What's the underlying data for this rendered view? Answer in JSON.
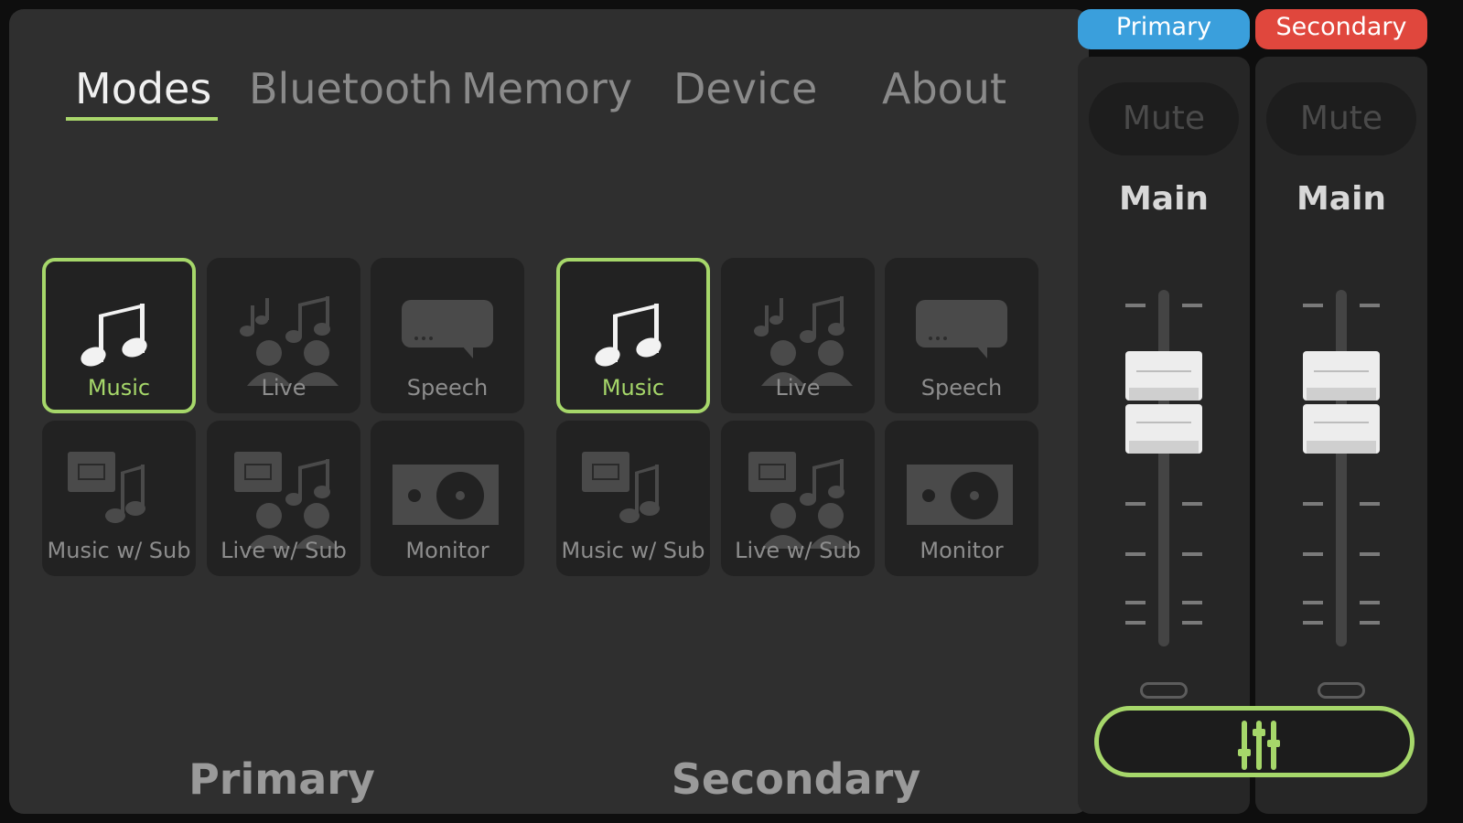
{
  "tabs": [
    {
      "label": "Modes",
      "active": true
    },
    {
      "label": "Bluetooth",
      "active": false
    },
    {
      "label": "Memory",
      "active": false
    },
    {
      "label": "Device",
      "active": false
    },
    {
      "label": "About",
      "active": false
    }
  ],
  "groups": [
    {
      "label": "Primary",
      "modes": [
        {
          "label": "Music",
          "icon": "music-note-icon",
          "selected": true
        },
        {
          "label": "Live",
          "icon": "live-audience-icon",
          "selected": false
        },
        {
          "label": "Speech",
          "icon": "speech-bubble-icon",
          "selected": false
        },
        {
          "label": "Music w/ Sub",
          "icon": "music-sub-icon",
          "selected": false
        },
        {
          "label": "Live w/ Sub",
          "icon": "live-sub-icon",
          "selected": false
        },
        {
          "label": "Monitor",
          "icon": "monitor-speaker-icon",
          "selected": false
        }
      ]
    },
    {
      "label": "Secondary",
      "modes": [
        {
          "label": "Music",
          "icon": "music-note-icon",
          "selected": true
        },
        {
          "label": "Live",
          "icon": "live-audience-icon",
          "selected": false
        },
        {
          "label": "Speech",
          "icon": "speech-bubble-icon",
          "selected": false
        },
        {
          "label": "Music w/ Sub",
          "icon": "music-sub-icon",
          "selected": false
        },
        {
          "label": "Live w/ Sub",
          "icon": "live-sub-icon",
          "selected": false
        },
        {
          "label": "Monitor",
          "icon": "monitor-speaker-icon",
          "selected": false
        }
      ]
    }
  ],
  "channels": [
    {
      "tag": "Primary",
      "tag_color": "#3a9fdc",
      "mute_label": "Mute",
      "title": "Main"
    },
    {
      "tag": "Secondary",
      "tag_color": "#e0473d",
      "mute_label": "Mute",
      "title": "Main"
    }
  ],
  "link_button": {
    "icon": "faders-icon"
  },
  "colors": {
    "accent": "#a6d76a",
    "primary": "#3a9fdc",
    "secondary": "#e0473d"
  }
}
